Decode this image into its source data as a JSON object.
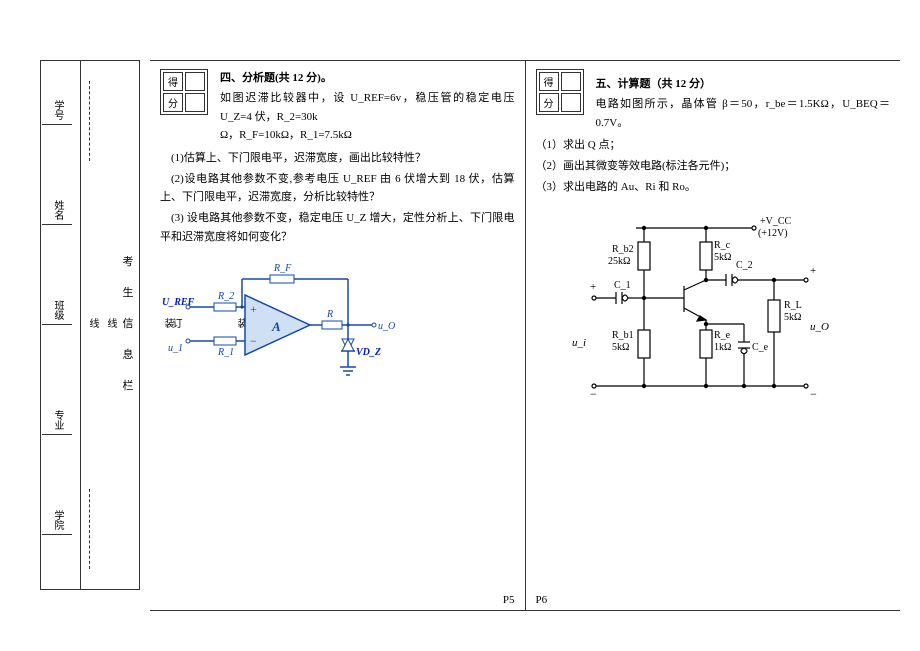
{
  "binding": {
    "main_label": "考 生 信 息 栏",
    "sub_labels": [
      "装",
      "订",
      "线"
    ],
    "sub2_labels": [
      "装",
      "线"
    ]
  },
  "side": {
    "field1": "学院",
    "field2": "专业",
    "field3": "班级",
    "field4": "姓名",
    "field5": "学号"
  },
  "score_box": {
    "row1": "得",
    "row2": "分"
  },
  "left": {
    "title": "四、分析题(共 12 分)。",
    "intro_l1": "如图迟滞比较器中，设 U_REF=6v，稳压管的稳定电压 U_Z=4 伏，R_2=30k",
    "intro_l2": "Ω，R_F=10kΩ，R_1=7.5kΩ",
    "q1": "(1)估算上、下门限电平，迟滞宽度，画出比较特性？",
    "q2": "(2)设电路其他参数不变,参考电压 U_REF 由 6 伏增大到 18 伏，估算上、下门限电平，迟滞宽度，分析比较特性？",
    "q3": "(3) 设电路其他参数不变，稳定电压 U_Z 增大，定性分析上、下门限电平和迟滞宽度将如何变化？",
    "circuit": {
      "Uref": "U_REF",
      "u1": "u_1",
      "R1": "R_1",
      "R2": "R_2",
      "RF": "R_F",
      "R": "R",
      "A": "A",
      "uo": "u_O",
      "VDz": "VD_Z"
    },
    "page": "P5"
  },
  "right": {
    "title": "五、计算题（共 12 分）",
    "intro": "电路如图所示，晶体管 β＝50，r_be＝1.5KΩ，U_BEQ＝0.7V。",
    "q1": "（1）求出 Q 点；",
    "q2": "（2）画出其微变等效电路(标注各元件)；",
    "q3": "（3）求出电路的 Au、Ri 和 Ro。",
    "circuit": {
      "Vcc": "+V_CC",
      "Vcc_val": "(+12V)",
      "Rb2": "R_b2",
      "Rb2_val": "25kΩ",
      "Rc": "R_c",
      "Rc_val": "5kΩ",
      "Rb1": "R_b1",
      "Rb1_val": "5kΩ",
      "Re": "R_e",
      "Re_val": "1kΩ",
      "RL": "R_L",
      "RL_val": "5kΩ",
      "C1": "C_1",
      "C2": "C_2",
      "Ce": "C_e",
      "ui": "u_i",
      "uo": "u_O",
      "plus": "+",
      "minus": "−"
    },
    "page": "P6"
  }
}
